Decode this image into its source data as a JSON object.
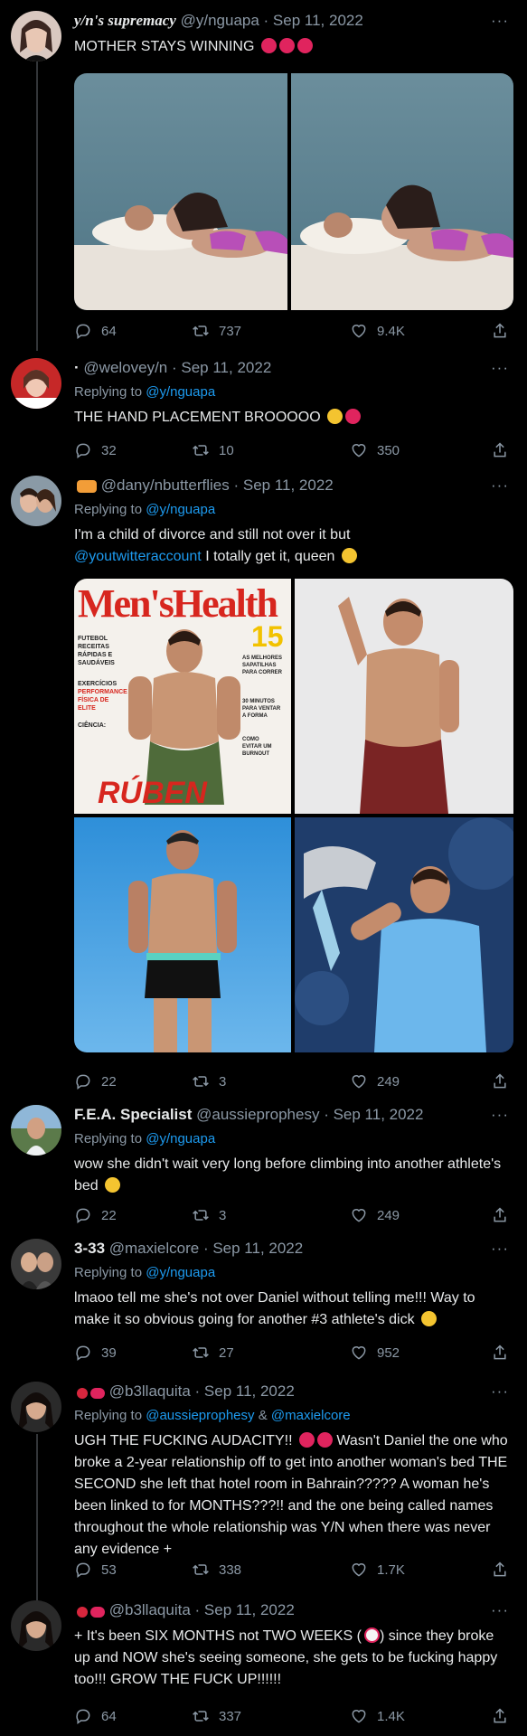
{
  "tweets": [
    {
      "name": "y/n's supremacy",
      "handle": "@y/nguapa",
      "date": "· Sep 11, 2022",
      "text": "MOTHER STAYS WINNING",
      "replies": "64",
      "retweets": "737",
      "likes": "9.4K"
    },
    {
      "name": "·",
      "handle": "@welovey/n",
      "date": "· Sep 11, 2022",
      "replying_prefix": "Replying to",
      "replying_to": "@y/nguapa",
      "text": "THE HAND PLACEMENT BROOOOO",
      "replies": "32",
      "retweets": "10",
      "likes": "350"
    },
    {
      "name": "",
      "handle": "@dany/nbutterflies",
      "date": "· Sep 11, 2022",
      "replying_prefix": "Replying to",
      "replying_to": "@y/nguapa",
      "text_line1": "I'm a child of divorce and still not over it but",
      "text_mention": "@youtwitteraccount",
      "text_line2": "I totally get it, queen",
      "magazine": {
        "title": "Men'sHealth",
        "name": "RÚBEN",
        "number": "15",
        "left_text": [
          "FUTEBOL",
          "RECEITAS",
          "RÁPIDAS E",
          "SAUDÁVEIS",
          "EXERCÍCIOS",
          "PERFORMANCE",
          "FÍSICA DE ELITE",
          "CIÊNCIA:"
        ],
        "right_text": [
          "AS MELHORES",
          "SAPATILHAS",
          "PARA CORRER",
          "30 MINUTOS",
          "PARA VENTAR",
          "A FORMA",
          "COMO",
          "EVITAR UM",
          "BURNOUT"
        ]
      },
      "replies": "22",
      "retweets": "3",
      "likes": "249"
    },
    {
      "name": "F.E.A. Specialist",
      "handle": "@aussieprophesy",
      "date": "· Sep 11, 2022",
      "replying_prefix": "Replying to",
      "replying_to": "@y/nguapa",
      "text": "wow she didn't wait very long before climbing into another athlete's bed",
      "replies": "22",
      "retweets": "3",
      "likes": "249"
    },
    {
      "name": "3-33",
      "handle": "@maxielcore",
      "date": "· Sep 11, 2022",
      "replying_prefix": "Replying to",
      "replying_to": "@y/nguapa",
      "text": "lmaoo tell me she's not over Daniel without telling me!!! Way to make it so obvious going for another #3 athlete's dick",
      "replies": "39",
      "retweets": "27",
      "likes": "952"
    },
    {
      "name": "",
      "handle": "@b3llaquita",
      "date": "· Sep 11, 2022",
      "replying_prefix": "Replying to",
      "replying_to": "@aussieprophesy",
      "replying_and": "&",
      "replying_to2": "@maxielcore",
      "text_a": "UGH THE FUCKING AUDACITY!!",
      "text_b": "Wasn't Daniel the one who broke a 2-year relationship off to get into another woman's bed THE SECOND she left that hotel room in Bahrain????? A woman he's been linked to for MONTHS???!! and the one being called names throughout the whole relationship was Y/N when there was never any evidence +",
      "replies": "53",
      "retweets": "338",
      "likes": "1.7K"
    },
    {
      "name": "",
      "handle": "@b3llaquita",
      "date": "· Sep 11, 2022",
      "text_a": "+ It's been SIX MONTHS not TWO WEEKS (",
      "text_b": ") since they broke up and NOW she's seeing someone, she gets to be fucking happy too!!! GROW THE FUCK UP!!!!!!",
      "replies": "64",
      "retweets": "337",
      "likes": "1.4K"
    }
  ],
  "more_label": "···",
  "ui": {
    "bg": "#000000",
    "text": "#e7e9ea",
    "muted": "#8b98a5",
    "link": "#1d9bf0",
    "line": "#333639"
  }
}
